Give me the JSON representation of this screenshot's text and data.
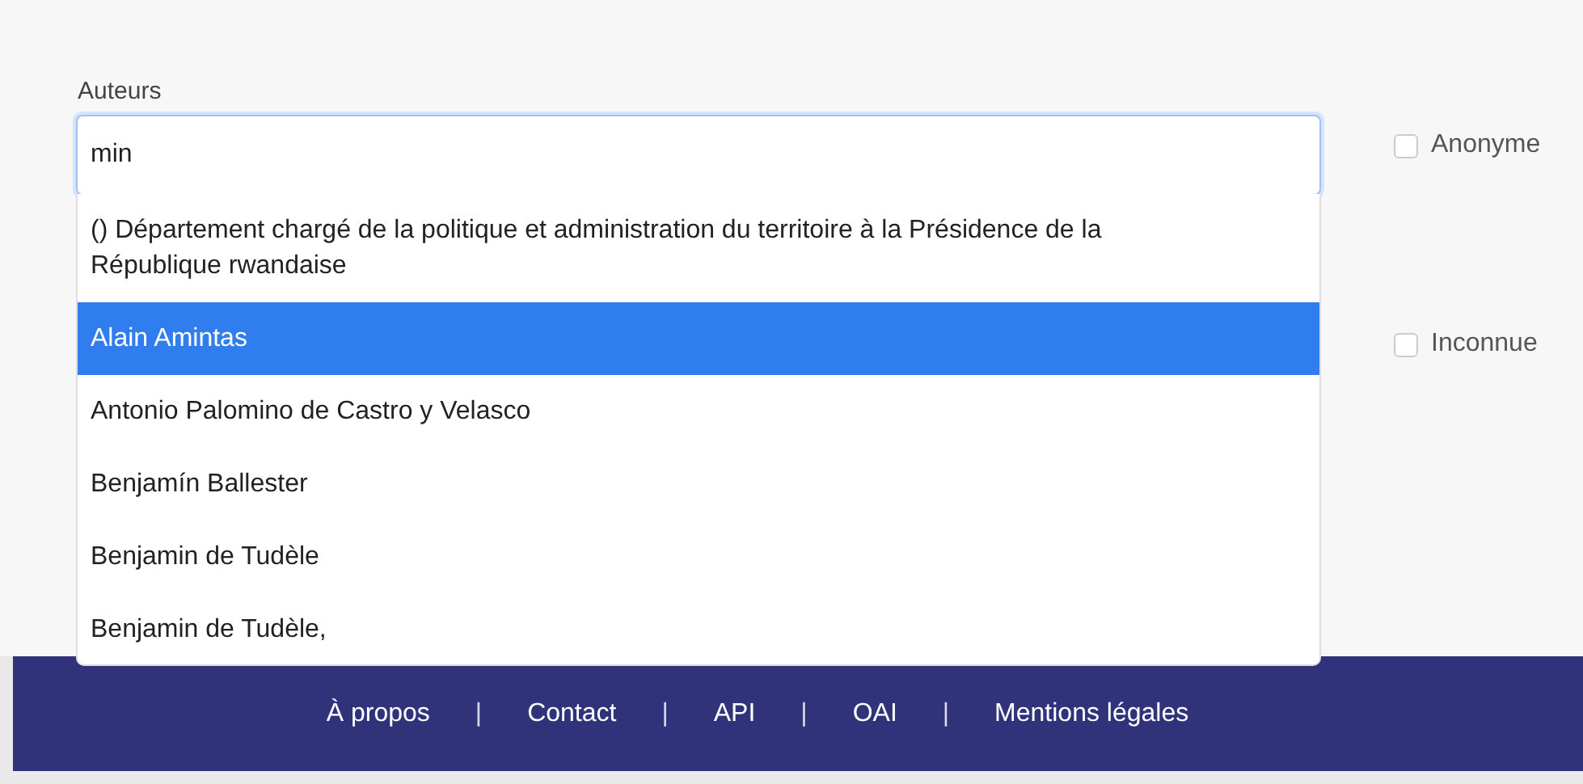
{
  "form": {
    "label": "Auteurs",
    "input": {
      "value": "min"
    },
    "options": [
      {
        "label": "() Département chargé de la politique et administration du territoire à la Présidence de la République rwandaise",
        "selected": false
      },
      {
        "label": "Alain Amintas",
        "selected": true
      },
      {
        "label": "Antonio Palomino de Castro y Velasco",
        "selected": false
      },
      {
        "label": "Benjamín Ballester",
        "selected": false
      },
      {
        "label": "Benjamin de Tudèle",
        "selected": false
      },
      {
        "label": "Benjamin de Tudèle,",
        "selected": false
      }
    ],
    "checkboxes": [
      {
        "label": "Anonyme",
        "checked": false
      },
      {
        "label": "Inconnue",
        "checked": false
      }
    ]
  },
  "footer": {
    "items": [
      {
        "kind": "link",
        "label": "À propos"
      },
      {
        "kind": "separator",
        "label": "|"
      },
      {
        "kind": "link",
        "label": "Contact"
      },
      {
        "kind": "separator",
        "label": "|"
      },
      {
        "kind": "link",
        "label": "API"
      },
      {
        "kind": "separator",
        "label": "|"
      },
      {
        "kind": "link",
        "label": "OAI"
      },
      {
        "kind": "separator",
        "label": "|"
      },
      {
        "kind": "link",
        "label": "Mentions légales"
      }
    ]
  }
}
